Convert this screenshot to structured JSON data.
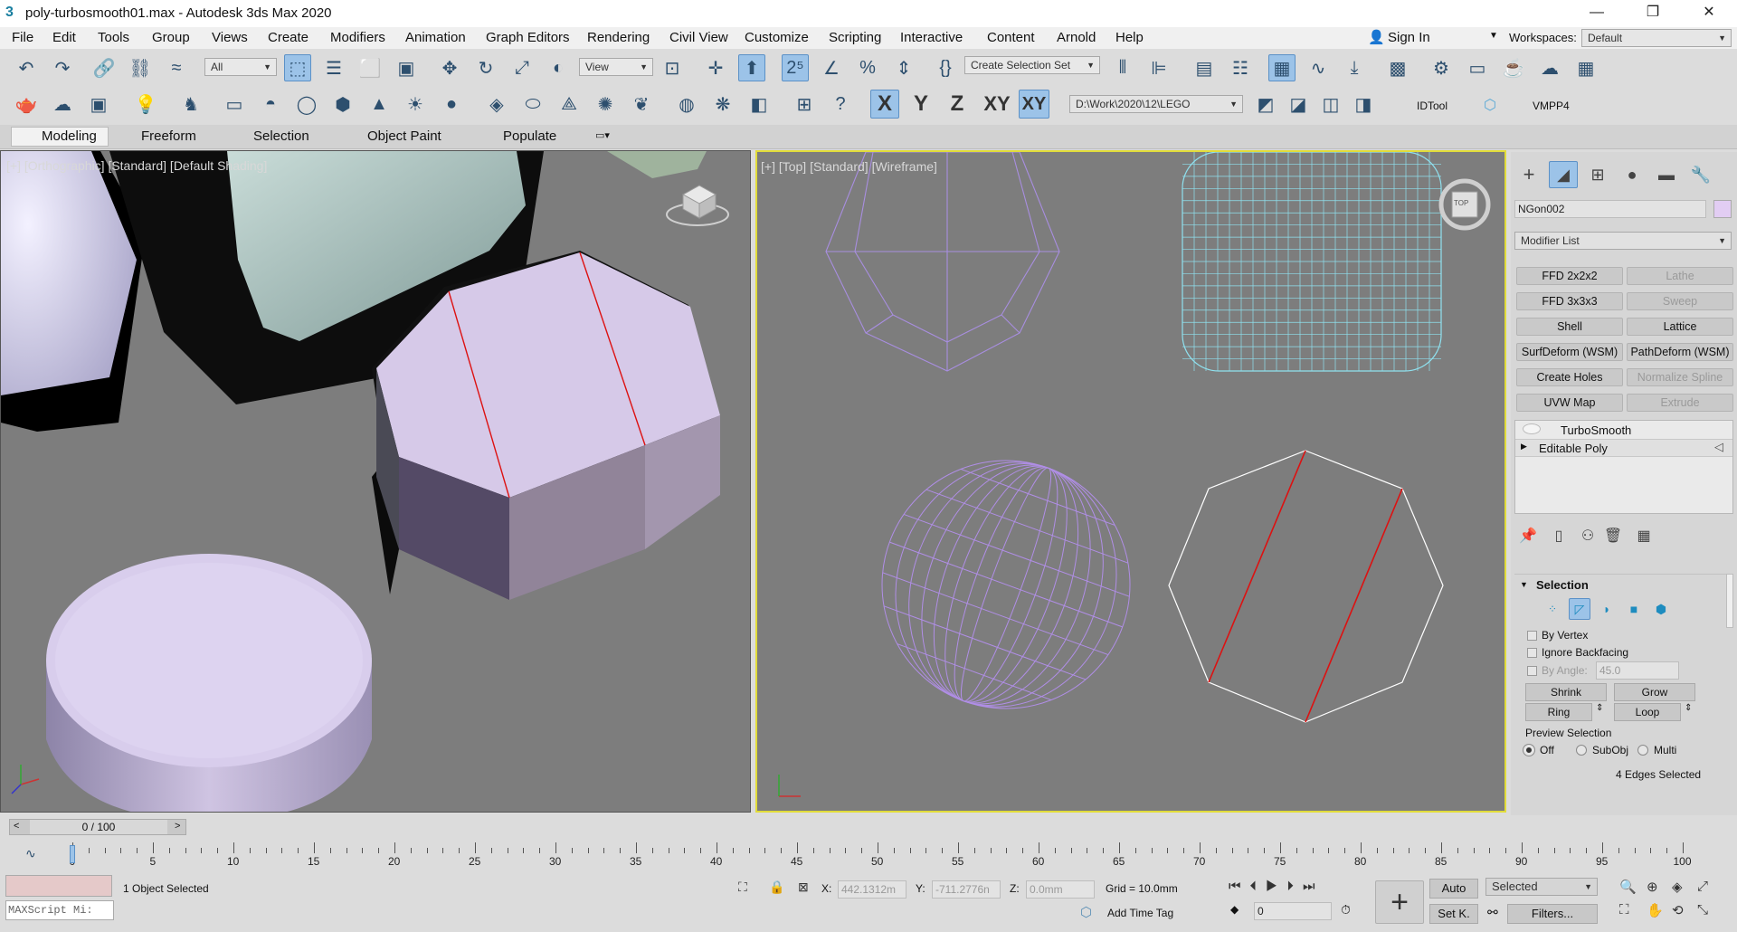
{
  "window": {
    "title": "poly-turbosmooth01.max - Autodesk 3ds Max 2020",
    "minimize": "—",
    "maximize": "❐",
    "close": "✕"
  },
  "menu": [
    "File",
    "Edit",
    "Tools",
    "Group",
    "Views",
    "Create",
    "Modifiers",
    "Animation",
    "Graph Editors",
    "Rendering",
    "Civil View",
    "Customize",
    "Scripting",
    "Interactive",
    "Content",
    "Arnold",
    "Help"
  ],
  "account": {
    "sign_in": "Sign In",
    "workspaces_label": "Workspaces:",
    "workspace_value": "Default"
  },
  "toolbar1": {
    "filter_value": "All",
    "ref_coord_value": "View",
    "selection_set_placeholder": "Create Selection Set"
  },
  "toolbar2": {
    "axis_x": "X",
    "axis_y": "Y",
    "axis_z": "Z",
    "axis_xy": "XY",
    "axis_xy2": "XY",
    "project_path": "D:\\Work\\2020\\12\\LEGO",
    "idtool": "IDTool",
    "vmpp4": "VMPP4"
  },
  "ribbon_tabs": [
    "Modeling",
    "Freeform",
    "Selection",
    "Object Paint",
    "Populate"
  ],
  "viewports": {
    "left_label": "[+] [Orthographic] [Standard] [Default Shading]",
    "right_label": "[+] [Top] [Standard] [Wireframe]",
    "viewcube_top": "TOP"
  },
  "command_panel": {
    "object_name": "NGon002",
    "object_color": "#e2cdf3",
    "modifier_list": "Modifier List",
    "modifier_buttons": [
      {
        "label": "FFD 2x2x2",
        "enabled": true
      },
      {
        "label": "Lathe",
        "enabled": false
      },
      {
        "label": "FFD 3x3x3",
        "enabled": true
      },
      {
        "label": "Sweep",
        "enabled": false
      },
      {
        "label": "Shell",
        "enabled": true
      },
      {
        "label": "Lattice",
        "enabled": true
      },
      {
        "label": "SurfDeform (WSM)",
        "enabled": true
      },
      {
        "label": "PathDeform (WSM)",
        "enabled": true
      },
      {
        "label": "Create Holes",
        "enabled": true
      },
      {
        "label": "Normalize Spline",
        "enabled": false
      },
      {
        "label": "UVW Map",
        "enabled": true
      },
      {
        "label": "Extrude",
        "enabled": false
      }
    ],
    "stack": [
      "TurboSmooth",
      "Editable Poly"
    ],
    "selection_rollout": {
      "title": "Selection",
      "by_vertex": "By Vertex",
      "ignore_backfacing": "Ignore Backfacing",
      "by_angle_label": "By Angle:",
      "by_angle_value": "45.0",
      "shrink": "Shrink",
      "grow": "Grow",
      "ring": "Ring",
      "loop": "Loop",
      "preview_selection": "Preview Selection",
      "off": "Off",
      "subobj": "SubObj",
      "multi": "Multi",
      "status": "4 Edges Selected"
    }
  },
  "timeline": {
    "slider_text": "0 / 100",
    "ticks": [
      "0",
      "5",
      "10",
      "15",
      "20",
      "25",
      "30",
      "35",
      "40",
      "45",
      "50",
      "55",
      "60",
      "65",
      "70",
      "75",
      "80",
      "85",
      "90",
      "95",
      "100"
    ]
  },
  "status_bar": {
    "maxscript_placeholder": "MAXScript Mi:",
    "status_text": "1 Object Selected",
    "x_label": "X:",
    "x_value": "442.1312m",
    "y_label": "Y:",
    "y_value": "-711.2776n",
    "z_label": "Z:",
    "z_value": "0.0mm",
    "grid": "Grid = 10.0mm",
    "add_time_tag": "Add Time Tag",
    "auto": "Auto",
    "set_key": "Set K.",
    "selected_dropdown": "Selected",
    "filters": "Filters...",
    "frame_value": "0"
  }
}
